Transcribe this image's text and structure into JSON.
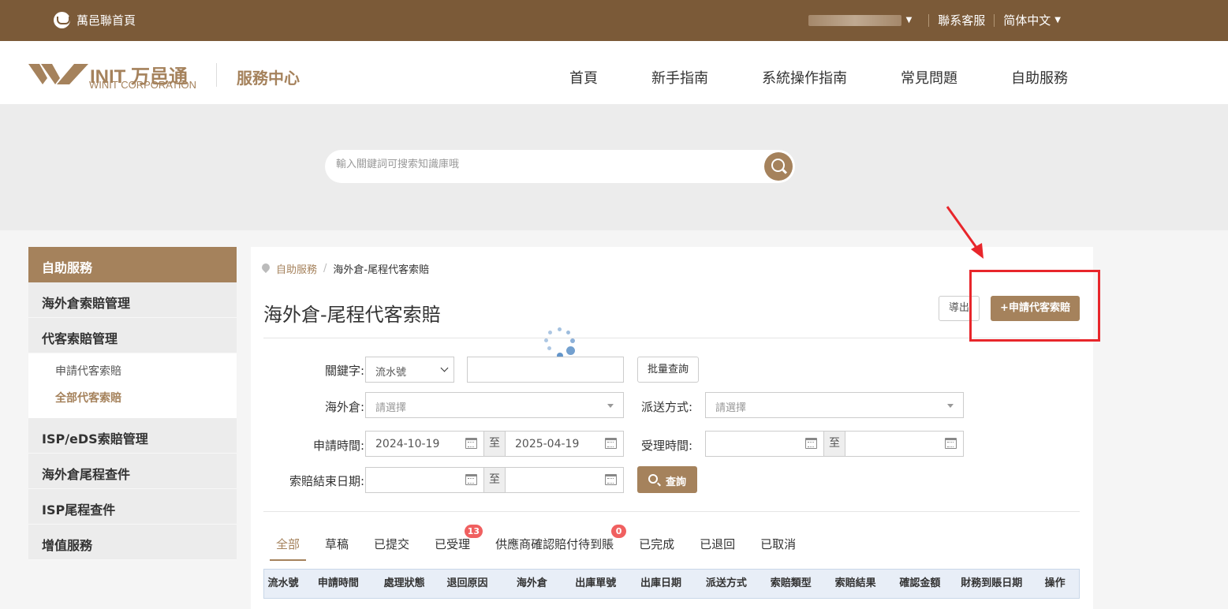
{
  "topbar": {
    "home_label": "萬邑聯首頁",
    "contact_label": "聯系客服",
    "language_label": "简体中文"
  },
  "header": {
    "logo_brand": "INIT 万邑通",
    "logo_corp": "WINIT CORPORATION",
    "service_title": "服務中心",
    "nav": [
      "首頁",
      "新手指南",
      "系統操作指南",
      "常見問題",
      "自助服務"
    ]
  },
  "search": {
    "placeholder": "輸入關鍵詞可搜索知識庫哦"
  },
  "sidebar": {
    "header": "自助服務",
    "items": [
      "海外倉索賠管理",
      "代客索賠管理",
      "ISP/eDS索賠管理",
      "海外倉尾程查件",
      "ISP尾程查件",
      "增值服務"
    ],
    "subitems": [
      "申請代客索賠",
      "全部代客索賠"
    ],
    "active_subitem": "全部代客索賠"
  },
  "breadcrumb": {
    "parent": "自助服務",
    "separator": "/",
    "current": "海外倉-尾程代客索賠"
  },
  "page": {
    "title": "海外倉-尾程代客索賠",
    "export_label": "導出",
    "apply_label": "+申請代客索賠"
  },
  "form": {
    "keyword_label": "關鍵字:",
    "keyword_type": "流水號",
    "keyword_value": "",
    "batch_query_label": "批量查詢",
    "warehouse_label": "海外倉:",
    "warehouse_placeholder": "請選擇",
    "delivery_label": "派送方式:",
    "delivery_placeholder": "請選擇",
    "apply_time_label": "申請時間:",
    "apply_time_from": "2024-10-19",
    "apply_time_to": "2025-04-19",
    "to_label": "至",
    "accept_time_label": "受理時間:",
    "accept_time_from": "",
    "accept_time_to": "",
    "claim_end_label": "索賠結束日期:",
    "claim_end_from": "",
    "claim_end_to": "",
    "query_label": "查詢"
  },
  "tabs": [
    {
      "label": "全部",
      "active": true
    },
    {
      "label": "草稿"
    },
    {
      "label": "已提交"
    },
    {
      "label": "已受理",
      "badge": "13"
    },
    {
      "label": "供應商確認賠付待到賬",
      "badge": "0"
    },
    {
      "label": "已完成"
    },
    {
      "label": "已退回"
    },
    {
      "label": "已取消"
    }
  ],
  "table": {
    "columns": [
      "流水號",
      "申請時間",
      "處理狀態",
      "退回原因",
      "海外倉",
      "出庫單號",
      "出庫日期",
      "派送方式",
      "索賠類型",
      "索賠結果",
      "確認金額",
      "財務到賬日期",
      "操作"
    ]
  },
  "colors": {
    "brand": "#a5825c",
    "topbar": "#7b5a38",
    "badge": "#f06060",
    "annotation": "#e8262b"
  }
}
